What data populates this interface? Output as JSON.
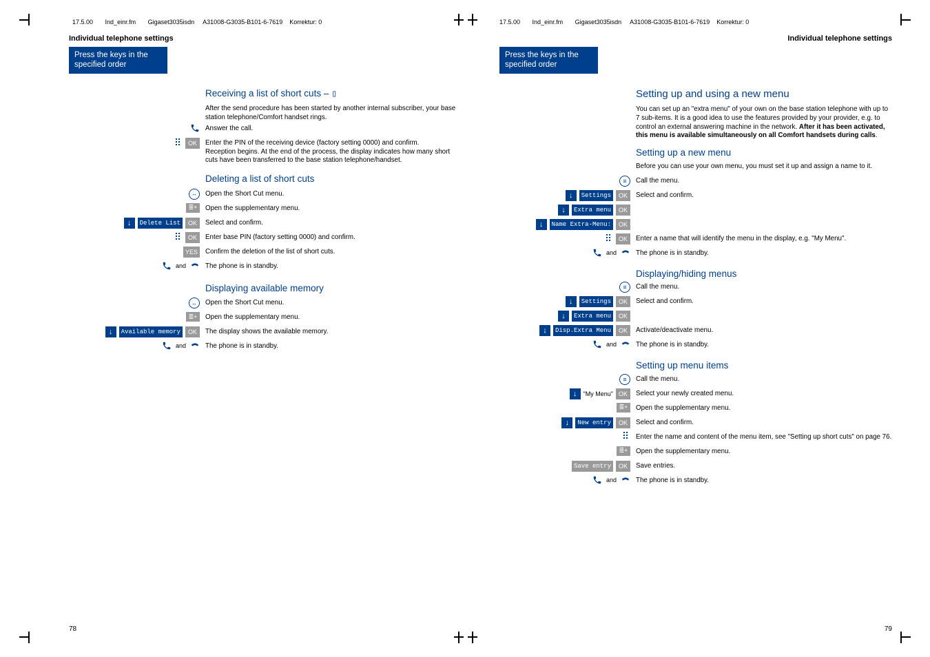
{
  "header": {
    "date": "17.5.00",
    "file": "Ind_einr.fm",
    "device": "Gigaset3035isdn",
    "part": "A31008-G3035-B101-6-7619",
    "korr": "Korrektur: 0"
  },
  "left": {
    "title": "Individual telephone settings",
    "strip1": "Press the keys in the",
    "strip2": "specified order",
    "h1": "Receiving a list of short cuts – ",
    "p1": "After the send procedure has been started by another internal subscriber, your base station telephone/Comfort handset rings.",
    "step_answer": "Answer the call.",
    "step_pin": "Enter the PIN of the receiving device (factory setting 0000) and confirm.\nReception begins. At the end of the process, the display indicates how many short cuts have been transferred to the base station telephone/handset.",
    "h2": "Deleting a list of short cuts",
    "d_open": "Open the Short Cut menu.",
    "d_supp": "Open the supplementary menu.",
    "d_select": "Select and confirm.",
    "d_pin": "Enter base PIN (factory setting 0000) and confirm.",
    "d_conf": "Confirm the deletion of the list of short cuts.",
    "d_stand": "The phone is in standby.",
    "h3": "Displaying available memory",
    "m_open": "Open the Short Cut menu.",
    "m_supp": "Open the supplementary menu.",
    "m_mem": "The display shows the available memory.",
    "m_stand": "The phone is in standby.",
    "k_delete": "Delete List",
    "k_avail": "Available memory",
    "ok": "OK",
    "yes": "YES",
    "page": "78"
  },
  "right": {
    "title": "Individual telephone settings",
    "strip1": "Press the keys in the",
    "strip2": "specified order",
    "h1": "Setting up and using a new menu",
    "p1a": "You can set up an \"extra menu\" of your own on the base station telephone with up to 7 sub-items. It is a good idea to use the features provided by your provider, e.g. to control an external answering machine in the network. ",
    "p1b": "After it has been activated, this menu is available simultaneously on all Comfort handsets during calls",
    "h2": "Setting up a new menu",
    "p2": "Before you can use your own menu, you must set it up and assign a name to it.",
    "call": "Call the menu.",
    "sel": "Select and confirm.",
    "entername": "Enter a name that will identify the menu in the display, e.g. \"My Menu\".",
    "standby": "The phone is in standby.",
    "h3": "Displaying/hiding menus",
    "act": "Activate/deactivate menu.",
    "h4": "Setting up menu items",
    "selnew": "Select your newly created menu.",
    "supp": "Open the supplementary menu.",
    "selconf": "Select and confirm.",
    "entercontent": "Enter the name and content of the menu item, see \"Setting up short cuts\" on page 76.",
    "save": "Save entries.",
    "k_settings": "Settings",
    "k_extra": "Extra menu",
    "k_name": "Name Extra-Menu:",
    "k_disp": "Disp.Extra Menu",
    "k_mymenu": "\"My Menu\"",
    "k_new": "New entry",
    "k_save": "Save entry",
    "ok": "OK",
    "page": "79"
  }
}
